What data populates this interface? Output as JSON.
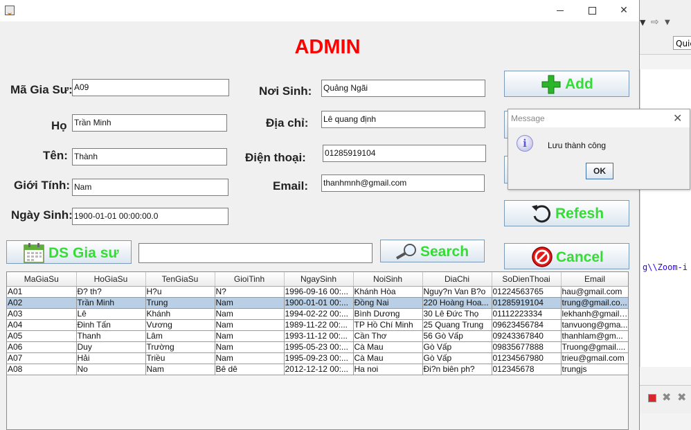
{
  "ide": {
    "quick_access": "Quic",
    "code_snippet": "g\\\\Zoom-i"
  },
  "window": {
    "title": ""
  },
  "heading": "ADMIN",
  "labels": {
    "ma_gia_su": "Mã Gia Sư:",
    "ho": "Họ",
    "ten": "Tên:",
    "gioi_tinh": "Giới Tính:",
    "ngay_sinh": "Ngày Sinh:",
    "noi_sinh": "Nơi Sinh:",
    "dia_chi": "Địa chỉ:",
    "dien_thoai": "Điện thoại:",
    "email": "Email:"
  },
  "fields": {
    "ma_gia_su": "A09",
    "ho": "Trần Minh",
    "ten": "Thành",
    "gioi_tinh": "Nam",
    "ngay_sinh": "1900-01-01 00:00:00.0",
    "noi_sinh": "Quảng Ngãi",
    "dia_chi": "Lê quang định",
    "dien_thoai": "01285919104",
    "email": "thanhmnh@gmail.com",
    "search": ""
  },
  "buttons": {
    "add": "Add",
    "refresh": "Refesh",
    "cancel": "Cancel",
    "ds_gia_su": "DS Gia sư",
    "search": "Search"
  },
  "table": {
    "columns": [
      "MaGiaSu",
      "HoGiaSu",
      "TenGiaSu",
      "GioiTinh",
      "NgaySinh",
      "NoiSinh",
      "DiaChi",
      "SoDienThoai",
      "Email"
    ],
    "rows": [
      [
        "A01",
        "Đ? th?",
        "H?u",
        "N?",
        "1996-09-16 00:...",
        "Khánh Hòa",
        "Nguy?n Van B?o",
        "01224563765",
        "hau@gmail.com"
      ],
      [
        "A02",
        "Trần Minh",
        "Trung",
        "Nam",
        "1900-01-01 00:...",
        "Đồng Nai",
        "220 Hoàng Hoa...",
        "01285919104",
        "trung@gmail.co..."
      ],
      [
        "A03",
        "Lê",
        "Khánh",
        "Nam",
        "1994-02-22 00:...",
        "Bình Dương",
        "30 Lê Đức Thọ",
        "01112223334",
        "lekhanh@gmail...."
      ],
      [
        "A04",
        "Đinh Tấn",
        "Vương",
        "Nam",
        "1989-11-22 00:...",
        "TP Hồ Chí Minh",
        "25 Quang Trung",
        "09623456784",
        "tanvuong@gma..."
      ],
      [
        "A05",
        "Thanh",
        "Lâm",
        "Nam",
        "1993-11-12 00:...",
        "Cần Thơ",
        "56 Gò Vấp",
        "09243367840",
        "thanhlam@gm..."
      ],
      [
        "A06",
        "Duy",
        "Trường",
        "Nam",
        "1995-05-23 00:...",
        "Cà Mau",
        "Gò Vấp",
        "09835677888",
        "Truong@gmail...."
      ],
      [
        "A07",
        "Hải",
        "Triều",
        "Nam",
        "1995-09-23 00:...",
        "Cà Mau",
        "Gò Vấp",
        "01234567980",
        "trieu@gmail.com"
      ],
      [
        "A08",
        "No",
        "Nam",
        "Bê dê",
        "2012-12-12 00:...",
        "Ha noi",
        "Đi?n biên ph?",
        "012345678",
        "trungjs"
      ]
    ],
    "selected_row": 1
  },
  "dialog": {
    "title": "Message",
    "message": "Lưu thành công",
    "ok": "OK"
  },
  "colors": {
    "heading": "#ff0000",
    "button_text": "#33dd33",
    "selection": "#b8cfe5"
  }
}
